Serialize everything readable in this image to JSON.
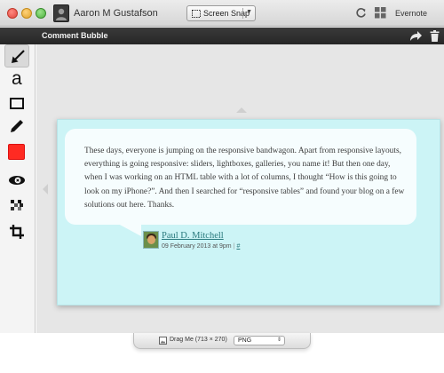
{
  "window": {
    "user_name": "Aaron M Gustafson",
    "snap_mode": "Screen Snap",
    "evernote_label": "Evernote"
  },
  "header": {
    "title": "Comment Bubble"
  },
  "tools": [
    {
      "icon": "arrow-icon",
      "active": true
    },
    {
      "icon": "text-icon",
      "glyph": "a"
    },
    {
      "icon": "rectangle-icon"
    },
    {
      "icon": "pen-icon"
    },
    {
      "icon": "color-swatch",
      "color": "#ff2a22"
    },
    {
      "icon": "blur-icon"
    },
    {
      "icon": "pixelate-icon"
    },
    {
      "icon": "crop-icon"
    }
  ],
  "comment": {
    "text": "These days, everyone is jumping on the responsive bandwagon. Apart from responsive layouts, everything is going responsive: sliders, lightboxes, galleries, you name it! But then one day, when I was working on an HTML table with a lot of columns, I thought “How is this going to look on my iPhone?”. And then I searched for “responsive tables” and found your blog on a few solutions out here. Thanks.",
    "author": "Paul D. Mitchell",
    "date": "09 February 2013 at 9pm",
    "separator": "|",
    "permalink": "#"
  },
  "colors": {
    "bubble_background": "#ccf4f6",
    "bubble_fill": "#f6fdfe",
    "accent_link": "#2a7a7e",
    "header_dark": "#2e2e2e"
  },
  "footer": {
    "drag_label": "Drag Me (713 × 270)",
    "format": "PNG"
  }
}
